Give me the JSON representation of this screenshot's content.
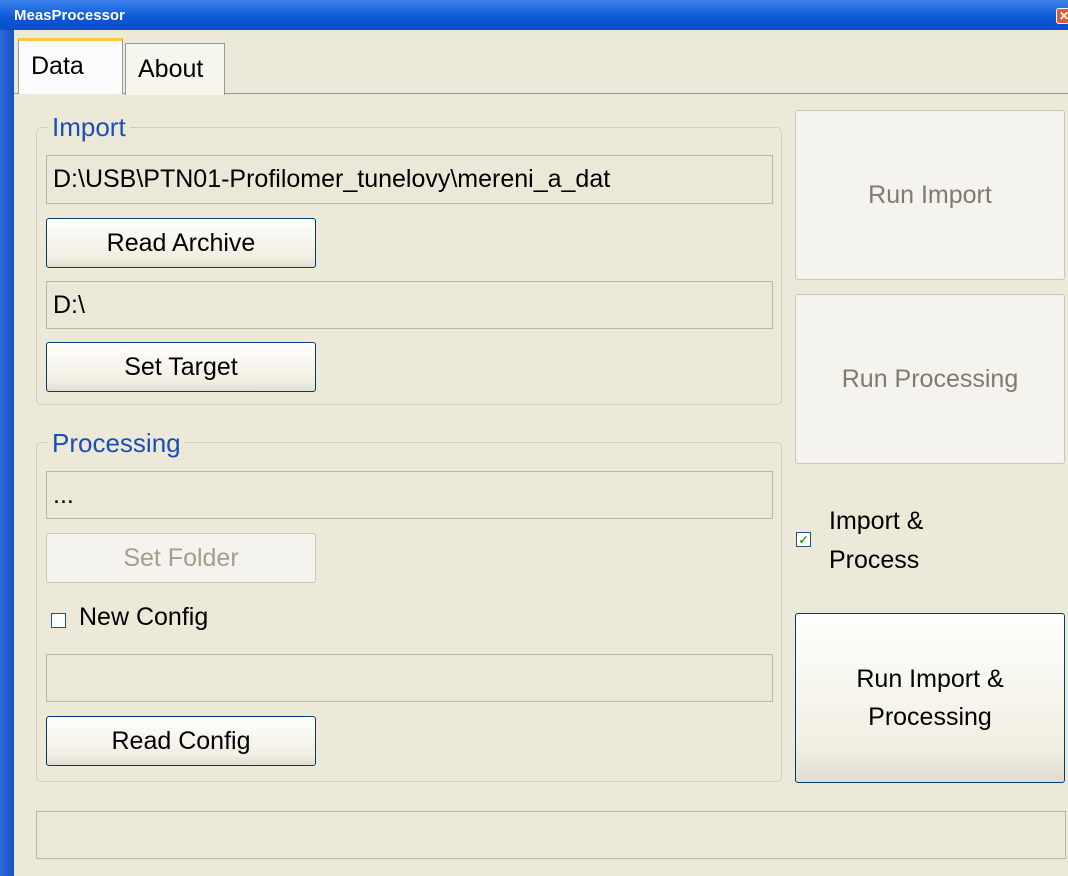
{
  "window": {
    "title": "MeasProcessor",
    "close_glyph": "✕"
  },
  "tabs": [
    {
      "label": "Data"
    },
    {
      "label": "About"
    }
  ],
  "import_group": {
    "label": "Import",
    "archive_path": "D:\\USB\\PTN01-Profilomer_tunelovy\\mereni_a_dat",
    "read_archive_label": "Read Archive",
    "target_path": "D:\\",
    "set_target_label": "Set Target"
  },
  "processing_group": {
    "label": "Processing",
    "folder_path": "...",
    "set_folder_label": "Set Folder",
    "new_config_label": "New Config",
    "new_config_checked": false,
    "config_path": "",
    "read_config_label": "Read Config"
  },
  "actions": {
    "run_import_label": "Run Import",
    "run_processing_label": "Run Processing",
    "import_and_process_line1": "Import &",
    "import_and_process_line2": "Process",
    "import_and_process_checked": true,
    "run_both_line1": "Run Import &",
    "run_both_line2": "Processing"
  },
  "status": {
    "text": ""
  },
  "colors": {
    "titlebar": "#0b57d6",
    "group_label": "#1b4fb8",
    "background": "#ece9d8"
  }
}
